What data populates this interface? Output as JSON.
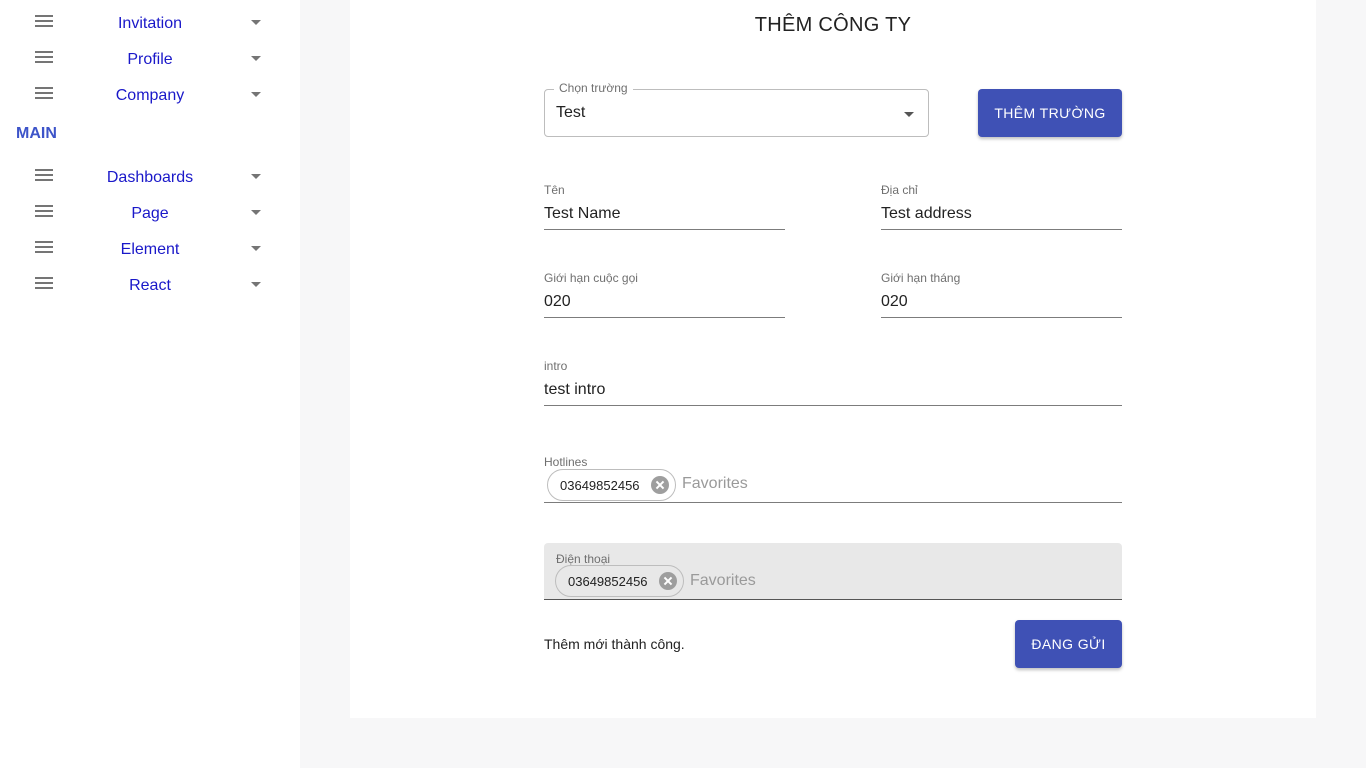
{
  "sidebar": {
    "items_top": [
      {
        "label": "Invitation"
      },
      {
        "label": "Profile"
      },
      {
        "label": "Company"
      }
    ],
    "section_title": "MAIN",
    "items_main": [
      {
        "label": "Dashboards"
      },
      {
        "label": "Page"
      },
      {
        "label": "Element"
      },
      {
        "label": "React"
      }
    ]
  },
  "form": {
    "title": "THÊM CÔNG TY",
    "select_field": {
      "label": "Chọn trường",
      "value": "Test"
    },
    "add_field_button": "THÊM TRƯỜNG",
    "name": {
      "label": "Tên",
      "value": "Test Name"
    },
    "address": {
      "label": "Địa chỉ",
      "value": "Test address"
    },
    "call_limit": {
      "label": "Giới hạn cuộc gọi",
      "value": "020"
    },
    "month_limit": {
      "label": "Giới hạn tháng",
      "value": "020"
    },
    "intro": {
      "label": "intro",
      "value": "test intro"
    },
    "hotlines": {
      "label": "Hotlines",
      "chips": [
        "03649852456"
      ],
      "placeholder": "Favorites"
    },
    "phone": {
      "label": "Điện thoại",
      "chips": [
        "03649852456"
      ],
      "placeholder": "Favorites"
    },
    "status_message": "Thêm mới thành công.",
    "submit_button": "ĐANG GỬI"
  },
  "colors": {
    "accent": "#3f51b5",
    "nav_link": "#1a18c9",
    "section_title": "#3d54c9",
    "background": "#f7f7f8"
  },
  "icons": {
    "nav": "menu-icon",
    "expand": "caret-down-icon",
    "chip_delete": "cancel-circle-icon"
  }
}
